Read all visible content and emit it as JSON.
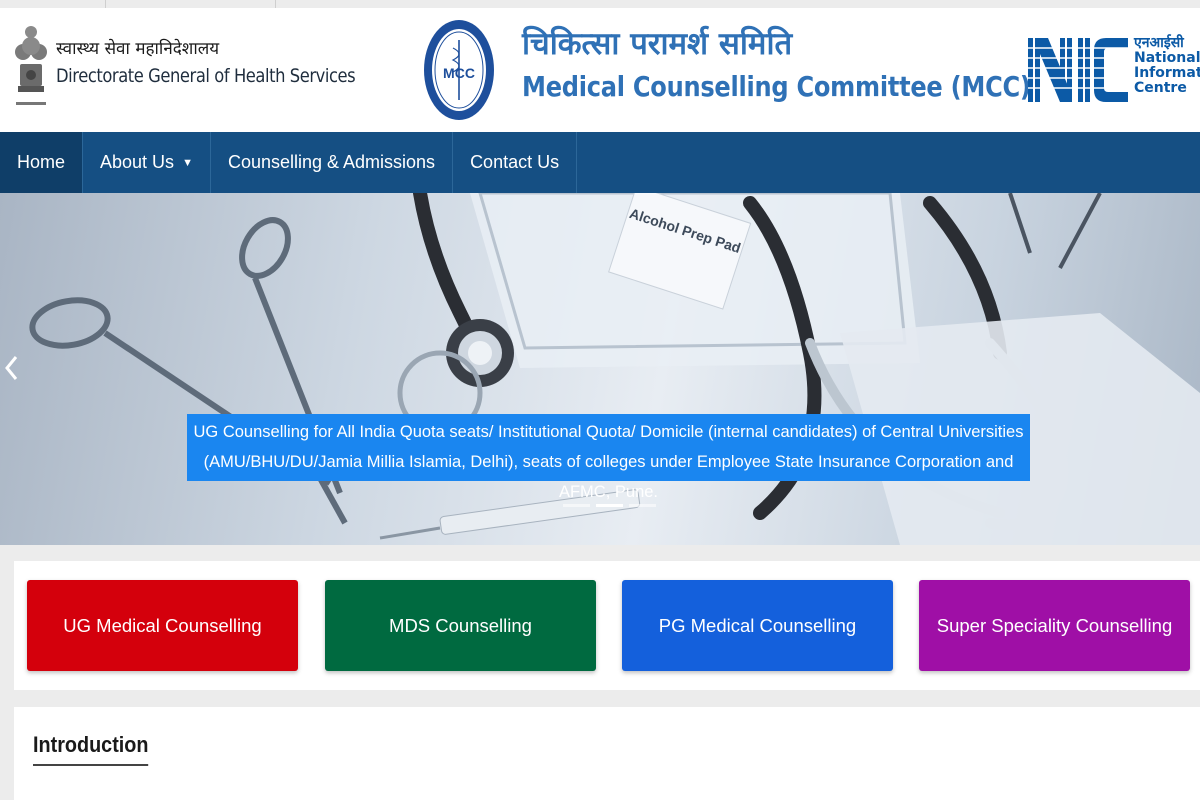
{
  "header": {
    "dghs_hindi": "स्वास्थ्य सेवा महानिदेशालय",
    "dghs_english": "Directorate General of Health Services",
    "mcc_logo_text": "MCC",
    "mcc_title_hindi": "चिकित्सा परामर्श समिति",
    "mcc_title_english": "Medical Counselling Committee (MCC)",
    "nic_hindi": "एनआईसी",
    "nic_line1": "National",
    "nic_line2": "Informatics",
    "nic_line3": "Centre"
  },
  "nav": {
    "items": [
      {
        "label": "Home",
        "active": true
      },
      {
        "label": "About Us",
        "dropdown": true
      },
      {
        "label": "Counselling & Admissions"
      },
      {
        "label": "Contact Us"
      }
    ]
  },
  "carousel": {
    "prev_icon": "chevron-left-icon",
    "pad_text": "Alcohol Prep Pad",
    "caption_line1": "UG Counselling for All India Quota seats/ Institutional Quota/ Domicile (internal candidates) of Central Universities",
    "caption_line2": "(AMU/BHU/DU/Jamia Millia Islamia, Delhi), seats of colleges under Employee State Insurance Corporation and AFMC, Pune.",
    "slide_count": 3,
    "active_slide": 2
  },
  "cards": [
    {
      "label": "UG Medical Counselling",
      "color": "#d4000c"
    },
    {
      "label": "MDS Counselling",
      "color": "#006a40"
    },
    {
      "label": "PG Medical Counselling",
      "color": "#1460dc"
    },
    {
      "label": "Super Speciality Counselling",
      "color": "#9f0fa6"
    }
  ],
  "intro": {
    "title": "Introduction"
  },
  "colors": {
    "nav_bg": "#154f83",
    "caption_bg": "#1a86f0",
    "title_blue": "#2f71b6"
  }
}
